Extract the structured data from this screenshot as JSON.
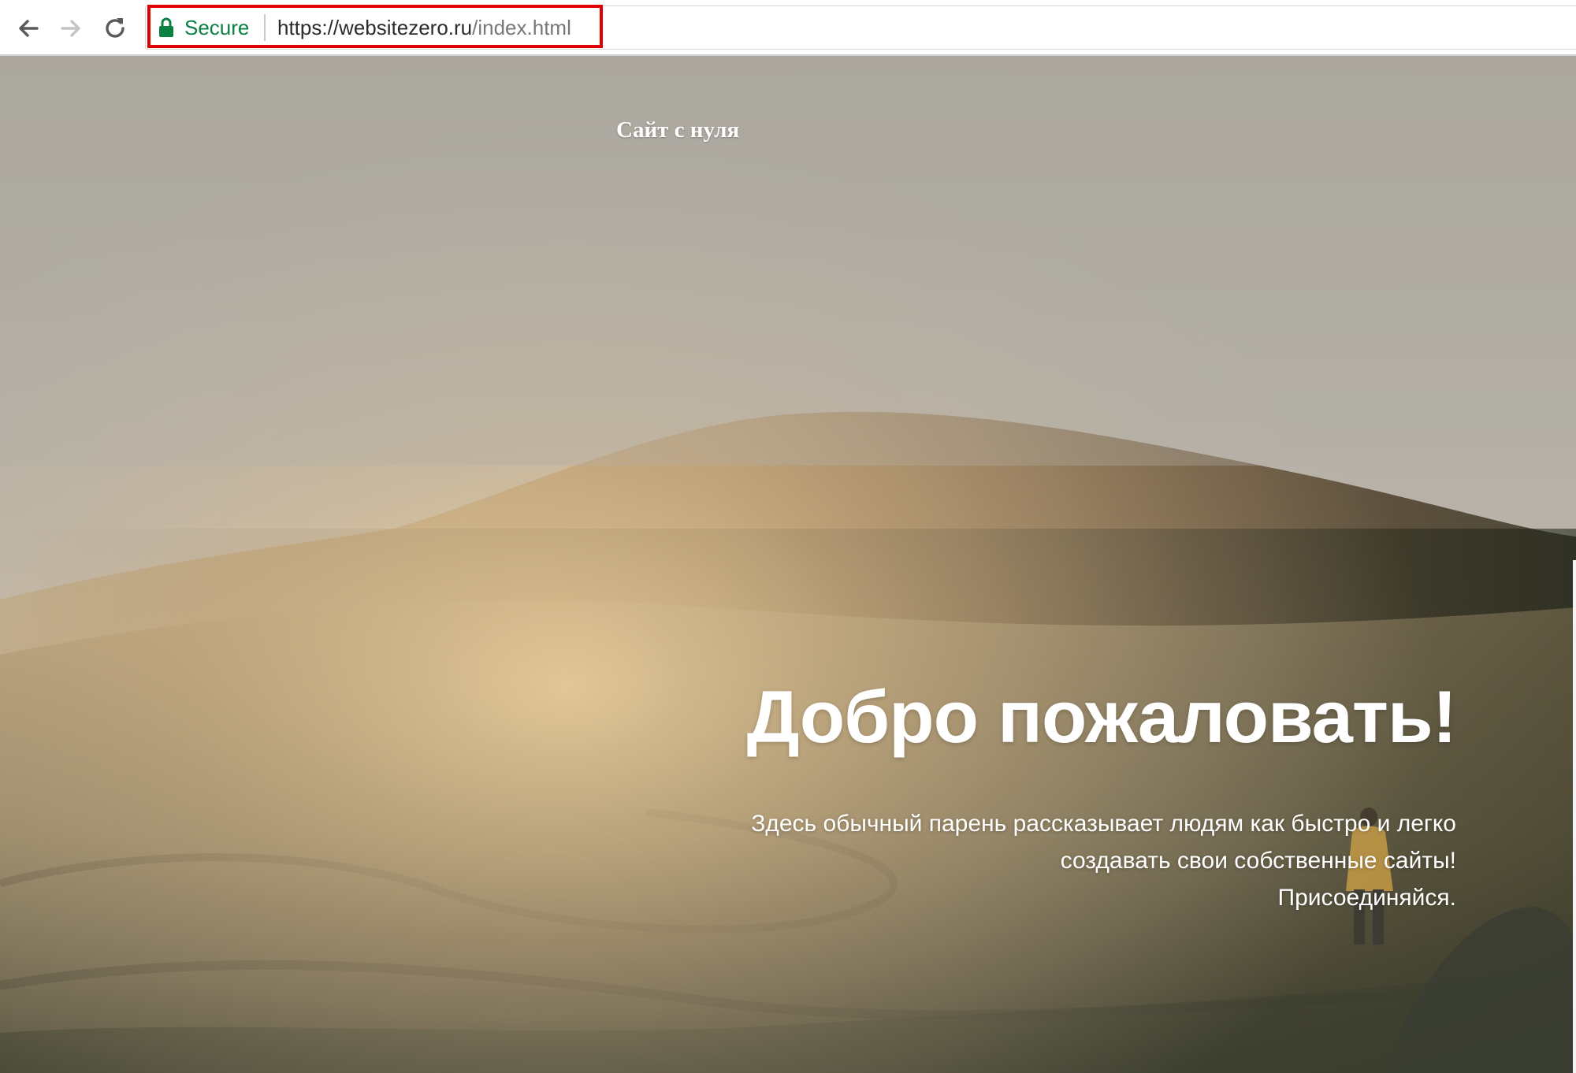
{
  "browser": {
    "security_label": "Secure",
    "url_host": "https://websitezero.ru",
    "url_path": "/index.html",
    "highlight_color": "#e00000",
    "secure_color": "#0b8043",
    "icons": {
      "back": "arrow-left-icon",
      "forward": "arrow-right-icon",
      "reload": "reload-icon",
      "lock": "lock-icon"
    }
  },
  "page": {
    "logo": "Сайт с нуля",
    "hero_title": "Добро пожаловать!",
    "hero_lines": [
      "Здесь обычный парень рассказывает людям как быстро и легко",
      "создавать свои собственные сайты!",
      "Присоединяйся."
    ]
  }
}
